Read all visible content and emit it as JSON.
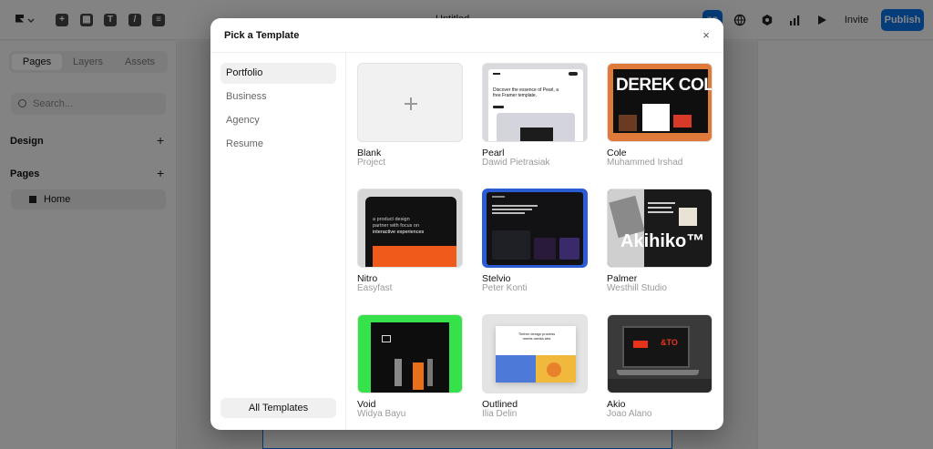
{
  "app": {
    "doc_title": "Untitled",
    "avatar_initials": "ZG",
    "invite_label": "Invite",
    "publish_label": "Publish",
    "sidebar": {
      "tabs": [
        "Pages",
        "Layers",
        "Assets"
      ],
      "active_tab": "Pages",
      "search_placeholder": "Search...",
      "design_label": "Design",
      "pages_label": "Pages",
      "home_label": "Home"
    }
  },
  "modal": {
    "title": "Pick a Template",
    "close_glyph": "×",
    "categories": [
      "Portfolio",
      "Business",
      "Agency",
      "Resume"
    ],
    "active_category": "Portfolio",
    "all_templates_label": "All Templates",
    "templates": [
      {
        "name": "Blank",
        "author": "Project"
      },
      {
        "name": "Pearl",
        "author": "Dawid Pietrasiak"
      },
      {
        "name": "Cole",
        "author": "Muhammed Irshad"
      },
      {
        "name": "Nitro",
        "author": "Easyfast"
      },
      {
        "name": "Stelvio",
        "author": "Peter Konti"
      },
      {
        "name": "Palmer",
        "author": "Westhill Studio"
      },
      {
        "name": "Void",
        "author": "Widya Bayu"
      },
      {
        "name": "Outlined",
        "author": "Ilia Delin"
      },
      {
        "name": "Akio",
        "author": "Joao Alano"
      }
    ],
    "thumb_text": {
      "pearl_heading": "Discover the essence of Pearl, a free Framer template.",
      "cole_heading": "DEREK COLE",
      "nitro_text_1": "a product design",
      "nitro_text_2": "partner with focus on",
      "nitro_text_3": "interactive experiences",
      "palmer_brand": "Akihiko™",
      "outlined_heading": "Timber design process meets media arts",
      "akio_tag": "&TO"
    }
  },
  "colors": {
    "accent": "#0b72e7",
    "publish_bg": "#0b72e7",
    "stelvio_border": "#2c5bd6",
    "void_bg": "#35e24a",
    "cole_bg": "#e07a3a",
    "nitro_orange": "#f05a1a"
  },
  "icons": {
    "logo": "framer-logo-icon",
    "insert": "plus-square-icon",
    "layout": "layout-icon",
    "text": "text-icon",
    "vector": "pen-icon",
    "cms": "database-icon",
    "globe": "globe-icon",
    "settings": "hexagon-settings-icon",
    "analytics": "bar-chart-icon",
    "preview": "play-icon",
    "close": "close-icon",
    "add": "plus-icon"
  }
}
